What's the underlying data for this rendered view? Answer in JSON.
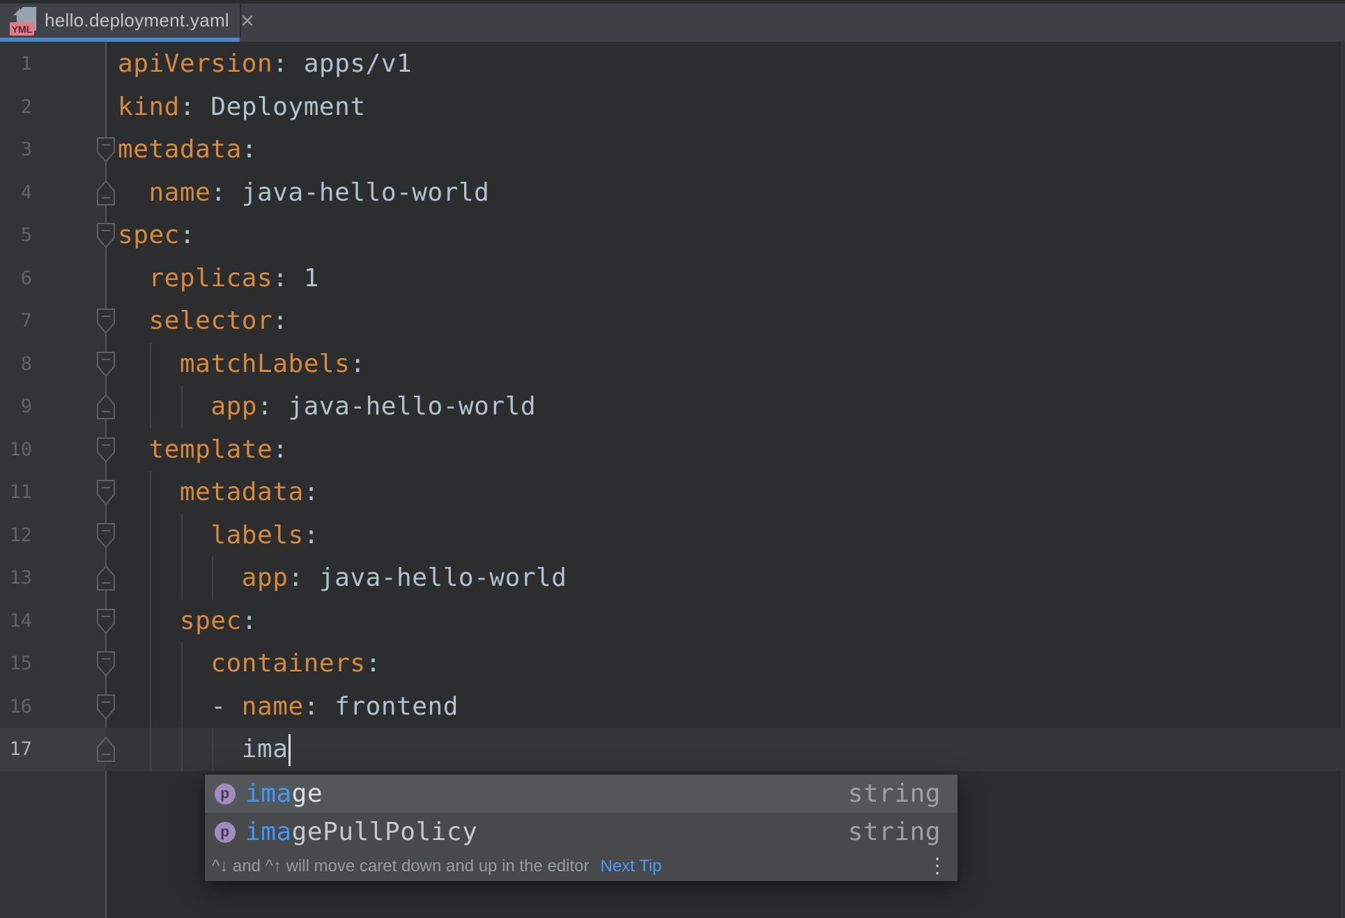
{
  "tab": {
    "title": "hello.deployment.yaml",
    "close_glyph": "×",
    "icon_badge": "YML",
    "underline_color": "#4a86c7"
  },
  "editor": {
    "lines": [
      {
        "n": 1,
        "indent": 0,
        "dash": false,
        "key": "apiVersion",
        "value": "apps/v1",
        "raw": null,
        "fold": null,
        "guides": [],
        "current": false
      },
      {
        "n": 2,
        "indent": 0,
        "dash": false,
        "key": "kind",
        "value": "Deployment",
        "raw": null,
        "fold": null,
        "guides": [],
        "current": false
      },
      {
        "n": 3,
        "indent": 0,
        "dash": false,
        "key": "metadata",
        "value": "",
        "raw": null,
        "fold": "start",
        "guides": [],
        "current": false
      },
      {
        "n": 4,
        "indent": 2,
        "dash": false,
        "key": "name",
        "value": "java-hello-world",
        "raw": null,
        "fold": "end",
        "guides": [],
        "current": false
      },
      {
        "n": 5,
        "indent": 0,
        "dash": false,
        "key": "spec",
        "value": "",
        "raw": null,
        "fold": "start",
        "guides": [],
        "current": false
      },
      {
        "n": 6,
        "indent": 2,
        "dash": false,
        "key": "replicas",
        "value": "1",
        "raw": null,
        "fold": null,
        "guides": [],
        "current": false
      },
      {
        "n": 7,
        "indent": 2,
        "dash": false,
        "key": "selector",
        "value": "",
        "raw": null,
        "fold": "start",
        "guides": [],
        "current": false
      },
      {
        "n": 8,
        "indent": 4,
        "dash": false,
        "key": "matchLabels",
        "value": "",
        "raw": null,
        "fold": "start",
        "guides": [
          2
        ],
        "current": false
      },
      {
        "n": 9,
        "indent": 6,
        "dash": false,
        "key": "app",
        "value": "java-hello-world",
        "raw": null,
        "fold": "end",
        "guides": [
          2,
          4
        ],
        "current": false
      },
      {
        "n": 10,
        "indent": 2,
        "dash": false,
        "key": "template",
        "value": "",
        "raw": null,
        "fold": "start",
        "guides": [],
        "current": false
      },
      {
        "n": 11,
        "indent": 4,
        "dash": false,
        "key": "metadata",
        "value": "",
        "raw": null,
        "fold": "start",
        "guides": [
          2
        ],
        "current": false
      },
      {
        "n": 12,
        "indent": 6,
        "dash": false,
        "key": "labels",
        "value": "",
        "raw": null,
        "fold": "start",
        "guides": [
          2,
          4
        ],
        "current": false
      },
      {
        "n": 13,
        "indent": 8,
        "dash": false,
        "key": "app",
        "value": "java-hello-world",
        "raw": null,
        "fold": "end",
        "guides": [
          2,
          4,
          6
        ],
        "current": false
      },
      {
        "n": 14,
        "indent": 4,
        "dash": false,
        "key": "spec",
        "value": "",
        "raw": null,
        "fold": "start",
        "guides": [
          2
        ],
        "current": false
      },
      {
        "n": 15,
        "indent": 6,
        "dash": false,
        "key": "containers",
        "value": "",
        "raw": null,
        "fold": "start",
        "guides": [
          2,
          4
        ],
        "current": false
      },
      {
        "n": 16,
        "indent": 6,
        "dash": true,
        "key": "name",
        "value": "frontend",
        "raw": null,
        "fold": "start",
        "guides": [
          2,
          4
        ],
        "current": false
      },
      {
        "n": 17,
        "indent": 8,
        "dash": false,
        "key": null,
        "value": null,
        "raw": "ima",
        "fold": "end",
        "guides": [
          2,
          4,
          6
        ],
        "current": true
      }
    ]
  },
  "completion": {
    "items": [
      {
        "icon_letter": "p",
        "match": "ima",
        "rest": "ge",
        "type": "string",
        "selected": true
      },
      {
        "icon_letter": "p",
        "match": "ima",
        "rest": "gePullPolicy",
        "type": "string",
        "selected": false
      }
    ],
    "hint": {
      "text": "^↓ and ^↑ will move caret down and up in the editor",
      "link": "Next Tip",
      "more_glyph": "⋮"
    }
  },
  "colors": {
    "editor_background": "#2b2d2e",
    "yaml_key": "#d6893f",
    "yaml_value": "#b3c0cd",
    "active_tab_underline": "#4a86c7",
    "completion_match": "#4298f7",
    "file_badge_pink": "#e27b8b"
  }
}
